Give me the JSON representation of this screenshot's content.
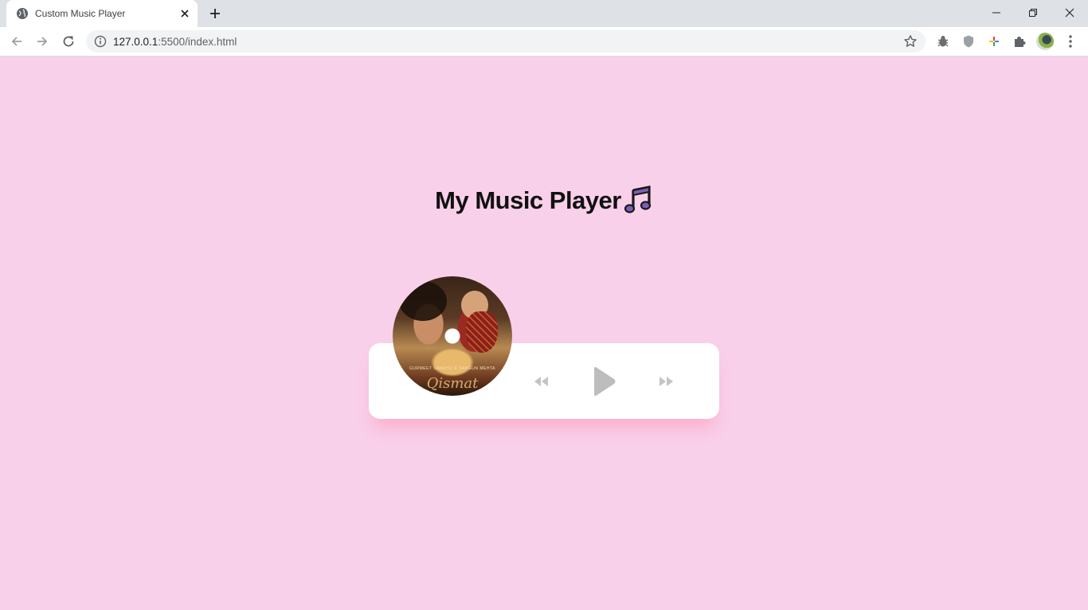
{
  "browser": {
    "tab_title": "Custom Music Player",
    "url_host": "127.0.0.1",
    "url_rest": ":5500/index.html"
  },
  "page": {
    "heading": "My Music Player",
    "heading_icon": "music-note-icon"
  },
  "player": {
    "album_art": {
      "caption": "GURMEET SANDHU & SARGUN MEHTA",
      "title": "Qismat"
    },
    "controls": [
      {
        "name": "previous",
        "icon": "backward-icon"
      },
      {
        "name": "play",
        "icon": "play-icon"
      },
      {
        "name": "next",
        "icon": "forward-icon"
      }
    ]
  },
  "colors": {
    "background": "#f9d0ea",
    "card": "#ffffff",
    "control": "#bdbdbd",
    "note_fill": "#7b5fb5"
  }
}
